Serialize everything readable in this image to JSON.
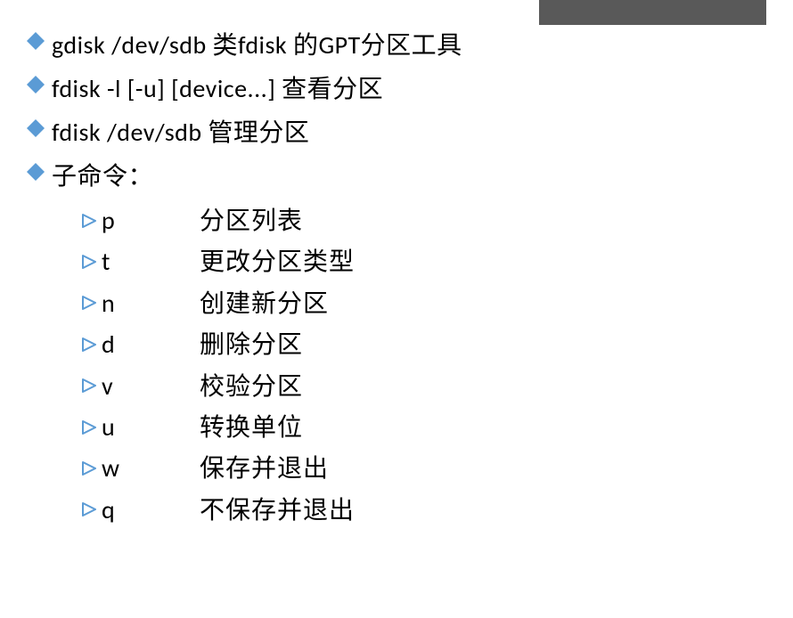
{
  "bullets": [
    {
      "text": "gdisk /dev/sdb 类fdisk 的GPT分区工具"
    },
    {
      "text": "fdisk -l [-u] [device...] 查看分区"
    },
    {
      "text": "fdisk /dev/sdb  管理分区"
    },
    {
      "text": "子命令："
    }
  ],
  "subcommands": [
    {
      "cmd": "p",
      "desc": "分区列表"
    },
    {
      "cmd": "t",
      "desc": "更改分区类型"
    },
    {
      "cmd": "n",
      "desc": "创建新分区"
    },
    {
      "cmd": "d",
      "desc": "删除分区"
    },
    {
      "cmd": "v",
      "desc": "校验分区"
    },
    {
      "cmd": "u",
      "desc": "转换单位"
    },
    {
      "cmd": "w",
      "desc": "保存并退出"
    },
    {
      "cmd": "q",
      "desc": "不保存并退出"
    }
  ]
}
